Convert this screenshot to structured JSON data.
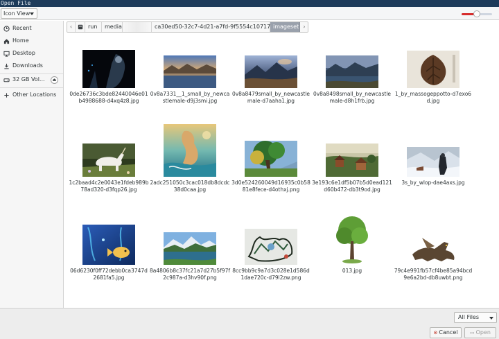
{
  "window": {
    "title": "Open File"
  },
  "header": {
    "view_mode": "Icon View",
    "zoom_level": 0.5
  },
  "sidebar": {
    "items": [
      {
        "label": "Recent",
        "icon": "clock-icon"
      },
      {
        "label": "Home",
        "icon": "home-icon"
      },
      {
        "label": "Desktop",
        "icon": "desktop-icon"
      },
      {
        "label": "Downloads",
        "icon": "download-icon"
      },
      {
        "label": "32 GB Vol...",
        "icon": "drive-icon"
      },
      {
        "label": "Other Locations",
        "icon": "plus-icon"
      }
    ]
  },
  "pathbar": {
    "segments": [
      "run",
      "media",
      "ca30ed50-32c7-4d21-a7fd-9f5554c10717",
      "imageset"
    ]
  },
  "files": [
    {
      "name": "0de26736c3bde82440046e01b4988688-d4xq4z8.jpg",
      "art": "dark-figure"
    },
    {
      "name": "0v8a7331__1_small_by_newcastlemale-d9j3smi.jpg",
      "art": "lake-sunset"
    },
    {
      "name": "0v8a8479small_by_newcastlemale-d7aaha1.jpg",
      "art": "mountain-dusk"
    },
    {
      "name": "0v8a8498small_by_newcastlemale-d8h1frb.jpg",
      "art": "hills-lake"
    },
    {
      "name": "1_by_massogeppotto-d7exo6d.jpg",
      "art": "wood-leaf"
    },
    {
      "name": "1c2baad4c2e0043e1fdeb989b78ad320-d3fqp26.jpg",
      "art": "unicorn"
    },
    {
      "name": "2adc251050c3cac018db8dcdc38d0caa.jpg",
      "art": "mermaid"
    },
    {
      "name": "3d0e524260049d16935c0b5881e8fece-d4othxj.png",
      "art": "fantasy-tree"
    },
    {
      "name": "3e193c6e1df5b07b5d0ead121d60b472-db3t9od.jpg",
      "art": "village"
    },
    {
      "name": "3s_by_wlop-dae4axs.jpg",
      "art": "snow-warrior"
    },
    {
      "name": "06d6230f0ff72debb0ca3747d2681fa5.jpg",
      "art": "fish-ocean"
    },
    {
      "name": "8a4806b8c37fc21a7d27b5f97f2c987a-d3hv90f.png",
      "art": "alpine-lake"
    },
    {
      "name": "8cc9bb9c9a7d3c028e1d586d1dae720c-d79l2zw.png",
      "art": "ink-city"
    },
    {
      "name": "013.jpg",
      "art": "green-tree"
    },
    {
      "name": "79c4e991fb57cf4be85a94bcd9e6a2bd-db8uwbt.png",
      "art": "dragon"
    },
    {
      "name": "",
      "art": "partial-1"
    },
    {
      "name": "",
      "art": "partial-2"
    }
  ],
  "footer": {
    "filter_label": "All Files",
    "cancel_label": "Cancel",
    "open_label": "Open"
  }
}
